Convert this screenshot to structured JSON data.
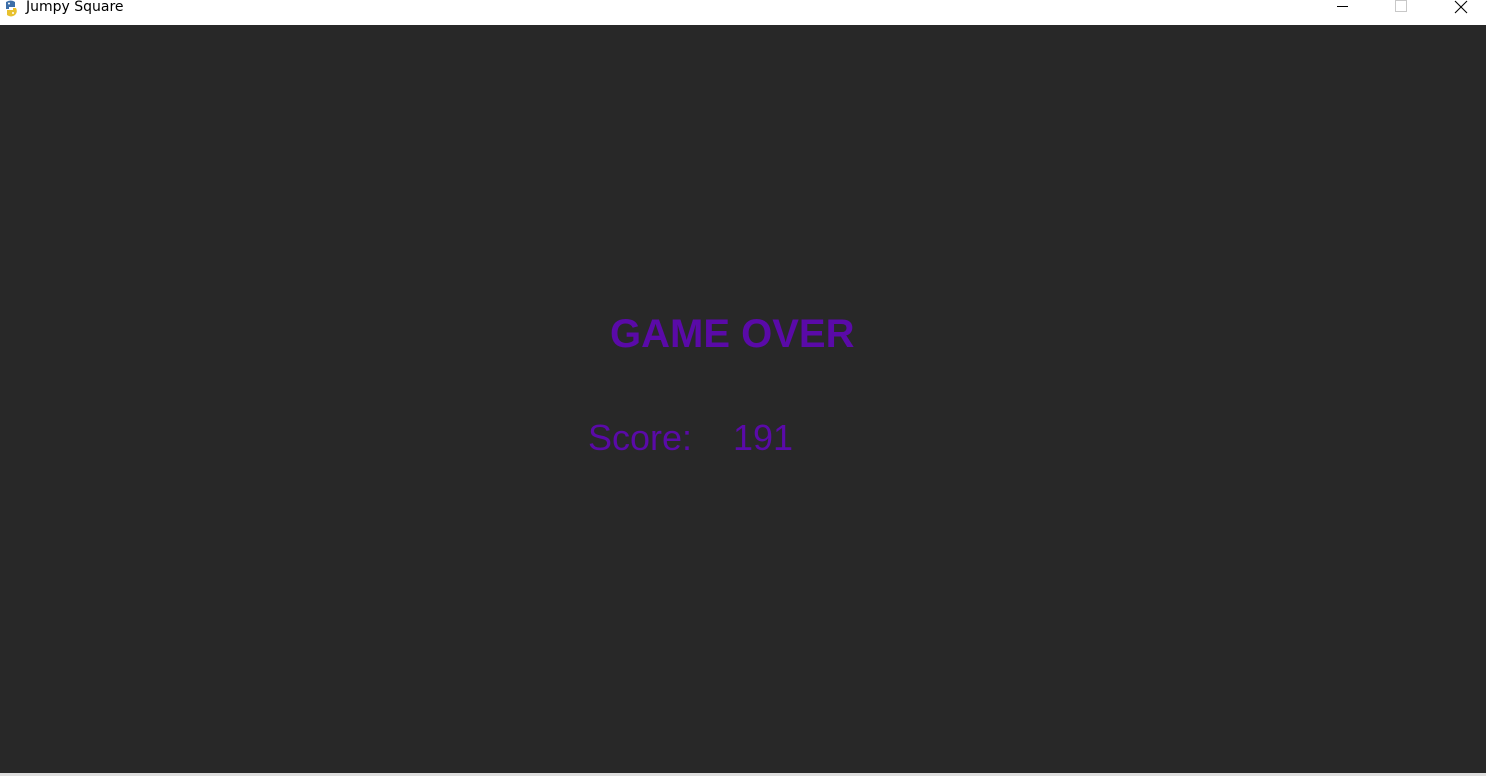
{
  "window": {
    "title": "Jumpy Square",
    "icon": "pygame-snake-icon"
  },
  "controls": {
    "minimize_icon": "minimize-icon",
    "maximize_icon": "maximize-icon",
    "close_icon": "close-icon"
  },
  "game": {
    "background_color": "#282828",
    "text_color": "#5a0aa8",
    "game_over_text": "GAME OVER",
    "score_label": "Score:",
    "score_value": "191"
  }
}
